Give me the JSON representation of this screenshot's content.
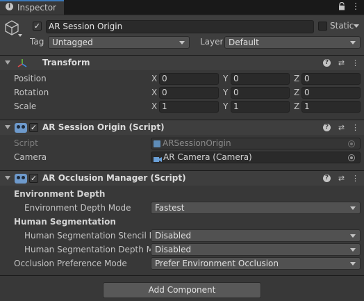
{
  "tab": {
    "label": "Inspector"
  },
  "object": {
    "enabled": true,
    "name": "AR Session Origin",
    "static_label": "Static",
    "tag_label": "Tag",
    "tag_value": "Untagged",
    "layer_label": "Layer",
    "layer_value": "Default"
  },
  "transform": {
    "title": "Transform",
    "rows": [
      {
        "label": "Position",
        "x": "0",
        "y": "0",
        "z": "0"
      },
      {
        "label": "Rotation",
        "x": "0",
        "y": "0",
        "z": "0"
      },
      {
        "label": "Scale",
        "x": "1",
        "y": "1",
        "z": "1"
      }
    ],
    "axes": {
      "x": "X",
      "y": "Y",
      "z": "Z"
    }
  },
  "session_origin": {
    "enabled": true,
    "title": "AR Session Origin (Script)",
    "script_label": "Script",
    "script_value": "ARSessionOrigin",
    "camera_label": "Camera",
    "camera_value": "AR Camera (Camera)"
  },
  "occlusion": {
    "enabled": true,
    "title": "AR Occlusion Manager (Script)",
    "env_header": "Environment Depth",
    "env_mode_label": "Environment Depth Mode",
    "env_mode_value": "Fastest",
    "human_header": "Human Segmentation",
    "stencil_label": "Human Segmentation Stencil Mo",
    "stencil_value": "Disabled",
    "depth_label": "Human Segmentation Depth Mo",
    "depth_value": "Disabled",
    "pref_label": "Occlusion Preference Mode",
    "pref_value": "Prefer Environment Occlusion"
  },
  "add_component": {
    "label": "Add Component"
  },
  "icons": {
    "help": "?",
    "settings": "⇄",
    "menu": "⋮",
    "lock": "🔒",
    "kebab": "⋮",
    "check": "✓"
  }
}
